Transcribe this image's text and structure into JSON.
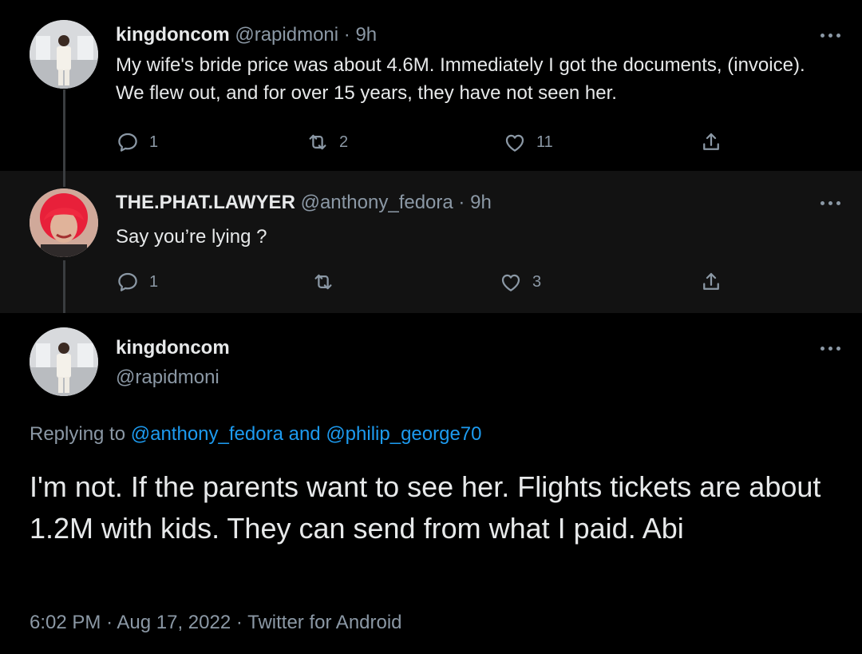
{
  "tweets": [
    {
      "name": "kingdoncom",
      "handle": "@rapidmoni",
      "separator": "·",
      "time": "9h",
      "text": "My wife's bride price was about 4.6M. Immediately I got the documents, (invoice). We flew out, and for over 15 years, they have not seen her.",
      "replies": "1",
      "retweets": "2",
      "likes": "11"
    },
    {
      "name": "THE.PHAT.LAWYER",
      "handle": "@anthony_fedora",
      "separator": "·",
      "time": "9h",
      "text": "Say you’re lying ?",
      "replies": "1",
      "retweets": "",
      "likes": "3"
    }
  ],
  "main_tweet": {
    "name": "kingdoncom",
    "handle": "@rapidmoni",
    "replying_prefix": "Replying to",
    "replying_to_1": "@anthony_fedora",
    "replying_and": "and",
    "replying_to_2": "@philip_george70",
    "text": "I'm not. If the parents want to see her. Flights tickets are about 1.2M with kids. They can send from what I paid. Abi",
    "time": "6:02 PM",
    "sep1": "·",
    "date": "Aug 17, 2022",
    "sep2": "·",
    "source": "Twitter for Android"
  },
  "icons": {
    "reply": "reply-icon",
    "retweet": "retweet-icon",
    "like": "heart-icon",
    "share": "share-icon",
    "more": "more-icon"
  },
  "colors": {
    "background": "#000000",
    "reply_background": "#121212",
    "text": "#e7e9ea",
    "muted": "#8b98a5",
    "link": "#1d9bf0"
  }
}
